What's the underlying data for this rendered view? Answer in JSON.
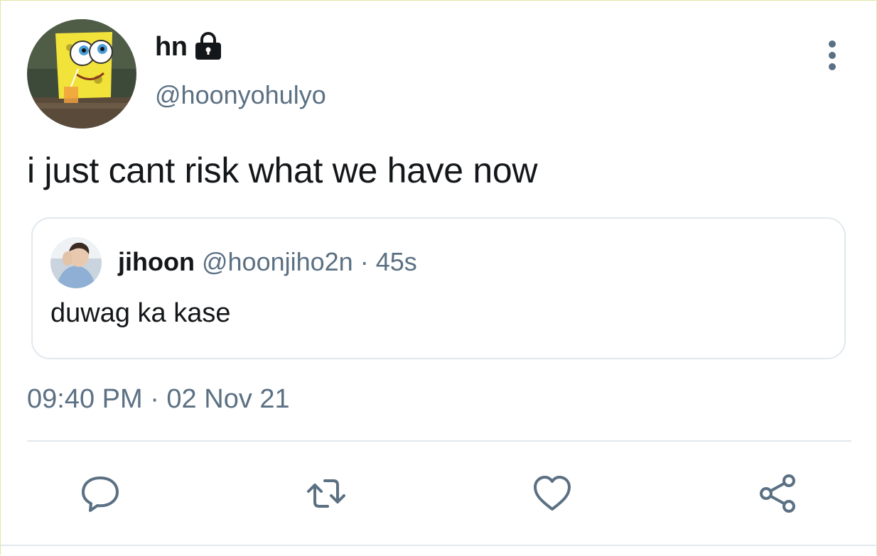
{
  "tweet": {
    "author": {
      "display_name": "hn",
      "handle": "@hoonyohulyo",
      "protected_icon": "lock-icon",
      "avatar": "spongebob-avatar"
    },
    "text": "i just cant risk what we have now",
    "timestamp": "09:40 PM · 02 Nov 21",
    "more_icon": "more-vertical-icon"
  },
  "quoted_tweet": {
    "display_name": "jihoon",
    "handle": "@hoonjiho2n",
    "separator": "·",
    "time": "45s",
    "text": "duwag ka kase",
    "avatar": "user-photo-avatar"
  },
  "actions": {
    "reply_icon": "comment-icon",
    "retweet_icon": "retweet-icon",
    "like_icon": "heart-icon",
    "share_icon": "share-icon"
  },
  "colors": {
    "primary_text": "#14171a",
    "secondary_text": "#5b7083",
    "border": "#e1e8ed",
    "icon": "#5b7083"
  }
}
